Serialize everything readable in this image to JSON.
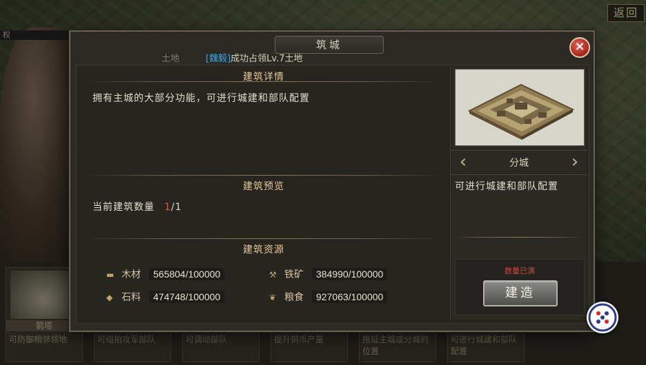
{
  "background": {
    "top_left_text": "权",
    "back_label": "返回",
    "cards": [
      {
        "title": "箭塔",
        "desc": "可防御相邻领地"
      },
      {
        "title": "",
        "desc": "可组拍攻军部队"
      },
      {
        "title": "",
        "desc": "可调动部队"
      },
      {
        "title": "",
        "desc": "提升铜币产量"
      },
      {
        "title": "",
        "desc": "拖延主城或分城的位置"
      },
      {
        "title": "",
        "desc": "可进行城建和部队配置"
      }
    ]
  },
  "panel": {
    "title": "筑城",
    "close_icon": "×",
    "ticker": {
      "prefix": "土地",
      "tag": "[魏毅]",
      "message": "成功占领Lv.7土地"
    },
    "detail": {
      "header": "建筑详情",
      "text": "拥有主城的大部分功能，可进行城建和部队配置"
    },
    "preview": {
      "header": "建筑预览",
      "count_label": "当前建筑数量",
      "count_current": "1",
      "count_total": "/1"
    },
    "resources": {
      "header": "建筑资源",
      "items": [
        {
          "icon": "wood-icon",
          "label": "木材",
          "value": "565804/100000"
        },
        {
          "icon": "iron-icon",
          "label": "铁矿",
          "value": "384990/100000"
        },
        {
          "icon": "stone-icon",
          "label": "石料",
          "value": "474748/100000"
        },
        {
          "icon": "grain-icon",
          "label": "粮食",
          "value": "927063/100000"
        }
      ]
    },
    "right": {
      "building_name": "分城",
      "description": "可进行城建和部队配置",
      "full_note": "数量已满",
      "build_label": "建造"
    }
  },
  "colors": {
    "accent_gold": "#e8c893",
    "alert_red": "#d2463c",
    "tag_blue": "#3ea6e0"
  }
}
